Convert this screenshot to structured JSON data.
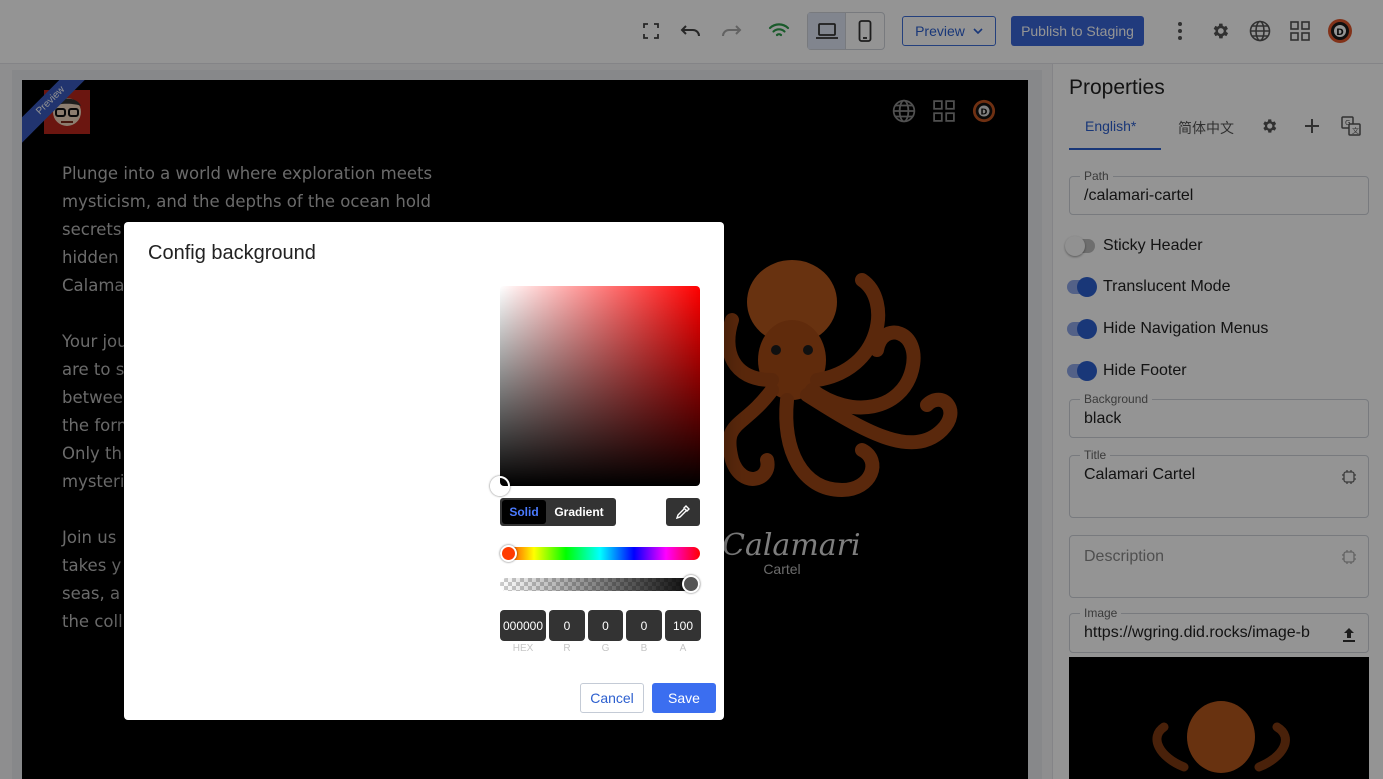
{
  "toolbar": {
    "preview_label": "Preview",
    "publish_label": "Publish to Staging"
  },
  "site": {
    "ribbon": "Preview",
    "text_blocks": [
      [
        "Plunge into a world where exploration meets",
        "mysticism, and the depths of the ocean hold",
        "secrets",
        "hidden",
        "Calama"
      ],
      [
        "Your jou",
        "are to s",
        "betwee",
        "the form",
        "Only th",
        "mysteri"
      ],
      [
        "Join us",
        "takes y",
        "seas, a",
        "the coll"
      ]
    ],
    "hero_title": "Calamari",
    "hero_subtitle": "Cartel"
  },
  "properties": {
    "heading": "Properties",
    "tabs": [
      "English*",
      "简体中文"
    ],
    "path_label": "Path",
    "path_value": "/calamari-cartel",
    "toggles": [
      {
        "label": "Sticky Header",
        "on": false
      },
      {
        "label": "Translucent Mode",
        "on": true
      },
      {
        "label": "Hide Navigation Menus",
        "on": true
      },
      {
        "label": "Hide Footer",
        "on": true
      }
    ],
    "background_label": "Background",
    "background_value": "black",
    "title_label": "Title",
    "title_value": "Calamari Cartel",
    "description_placeholder": "Description",
    "image_label": "Image",
    "image_value": "https://wgring.did.rocks/image-b"
  },
  "dialog": {
    "title": "Config background",
    "modes": [
      "Solid",
      "Gradient"
    ],
    "active_mode": "Solid",
    "hex": "000000",
    "r": "0",
    "g": "0",
    "b": "0",
    "a": "100",
    "labels": {
      "hex": "HEX",
      "r": "R",
      "g": "G",
      "b": "B",
      "a": "A"
    },
    "cancel_label": "Cancel",
    "save_label": "Save"
  },
  "colors": {
    "accent": "#3a67d8",
    "save": "#3b6ef0",
    "hue_marker": "#ff3b00"
  }
}
